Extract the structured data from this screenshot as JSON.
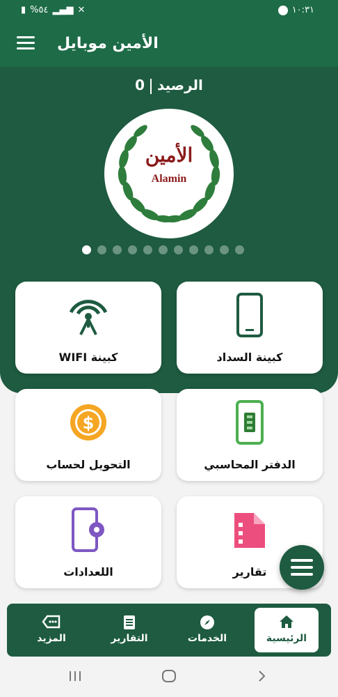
{
  "status_bar": {
    "time": "١٠:٣١",
    "battery": "%٥٤"
  },
  "app_bar": {
    "title": "الأمين موبايل",
    "menu_icon": "hamburger-icon"
  },
  "balance": {
    "label": "الرصيد",
    "value": "0"
  },
  "logo": {
    "arabic": "الأمين",
    "english": "Alamin"
  },
  "carousel": {
    "total_dots": 11,
    "active_index": 0
  },
  "cards": [
    {
      "label": "كبينة السداد",
      "icon": "phone-icon"
    },
    {
      "label": "كبينة WIFI",
      "icon": "wifi-tower-icon"
    },
    {
      "label": "الدفتر المحاسبي",
      "icon": "ledger-phone-icon"
    },
    {
      "label": "التحويل لحساب",
      "icon": "dollar-coin-icon"
    },
    {
      "label": "تقارير",
      "icon": "report-document-icon"
    },
    {
      "label": "اللعدادات",
      "icon": "settings-phone-icon"
    }
  ],
  "bottom_nav": [
    {
      "label": "الرئيسية",
      "icon": "home-icon",
      "active": true
    },
    {
      "label": "الخدمات",
      "icon": "compass-icon",
      "active": false
    },
    {
      "label": "التقارير",
      "icon": "receipt-icon",
      "active": false
    },
    {
      "label": "المزيد",
      "icon": "more-tag-icon",
      "active": false
    }
  ],
  "colors": {
    "primary": "#1e5b40",
    "status_bar": "#1d6b47",
    "logo_red": "#8b1a1a",
    "wreath_green": "#2e7d3c"
  }
}
